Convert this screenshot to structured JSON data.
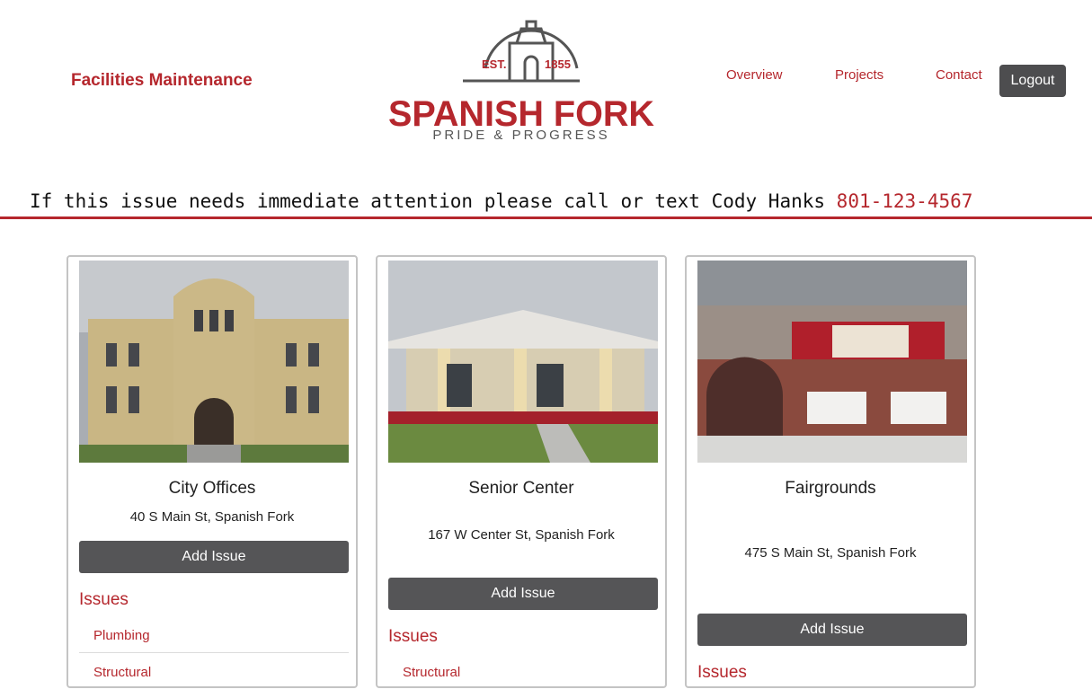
{
  "header": {
    "brand": "Facilities Maintenance",
    "logo": {
      "est": "EST.",
      "year": "1855",
      "name": "SPANISH FORK",
      "tagline": "PRIDE & PROGRESS"
    },
    "nav": [
      "Overview",
      "Projects",
      "Contact"
    ],
    "logout": "Logout"
  },
  "notice": {
    "text": "If this issue needs immediate attention please call or text Cody Hanks",
    "phone": "801-123-4567"
  },
  "colors": {
    "accent": "#b5272d",
    "button": "#555557"
  },
  "facilities": [
    {
      "name": "City Offices",
      "address": "40 S Main St, Spanish Fork",
      "add_label": "Add Issue",
      "issues_label": "Issues",
      "issues": [
        "Plumbing",
        "Structural"
      ]
    },
    {
      "name": "Senior Center",
      "address": "167 W Center St, Spanish Fork",
      "add_label": "Add Issue",
      "issues_label": "Issues",
      "issues": [
        "Structural"
      ]
    },
    {
      "name": "Fairgrounds",
      "address": "475 S Main St, Spanish Fork",
      "add_label": "Add Issue",
      "issues_label": "Issues",
      "issues": []
    }
  ]
}
